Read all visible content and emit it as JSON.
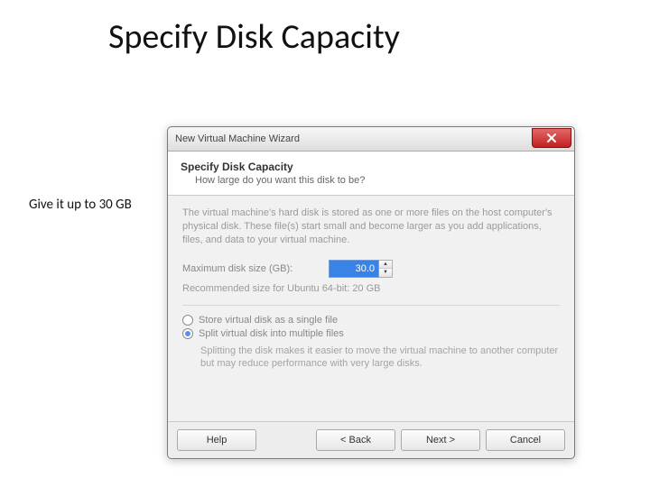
{
  "slide": {
    "title": "Specify Disk Capacity",
    "side_note": "Give it up to 30 GB"
  },
  "wizard": {
    "window_title": "New Virtual Machine Wizard",
    "header_title": "Specify Disk Capacity",
    "header_question": "How large do you want this disk to be?",
    "description": "The virtual machine's hard disk is stored as one or more files on the host computer's physical disk. These file(s) start small and become larger as you add applications, files, and data to your virtual machine.",
    "max_disk_label": "Maximum disk size (GB):",
    "max_disk_value": "30.0",
    "recommended": "Recommended size for Ubuntu 64-bit: 20 GB",
    "options": {
      "single": "Store virtual disk as a single file",
      "split": "Split virtual disk into multiple files",
      "split_note": "Splitting the disk makes it easier to move the virtual machine to another computer but may reduce performance with very large disks."
    },
    "buttons": {
      "help": "Help",
      "back": "< Back",
      "next": "Next >",
      "cancel": "Cancel"
    }
  }
}
